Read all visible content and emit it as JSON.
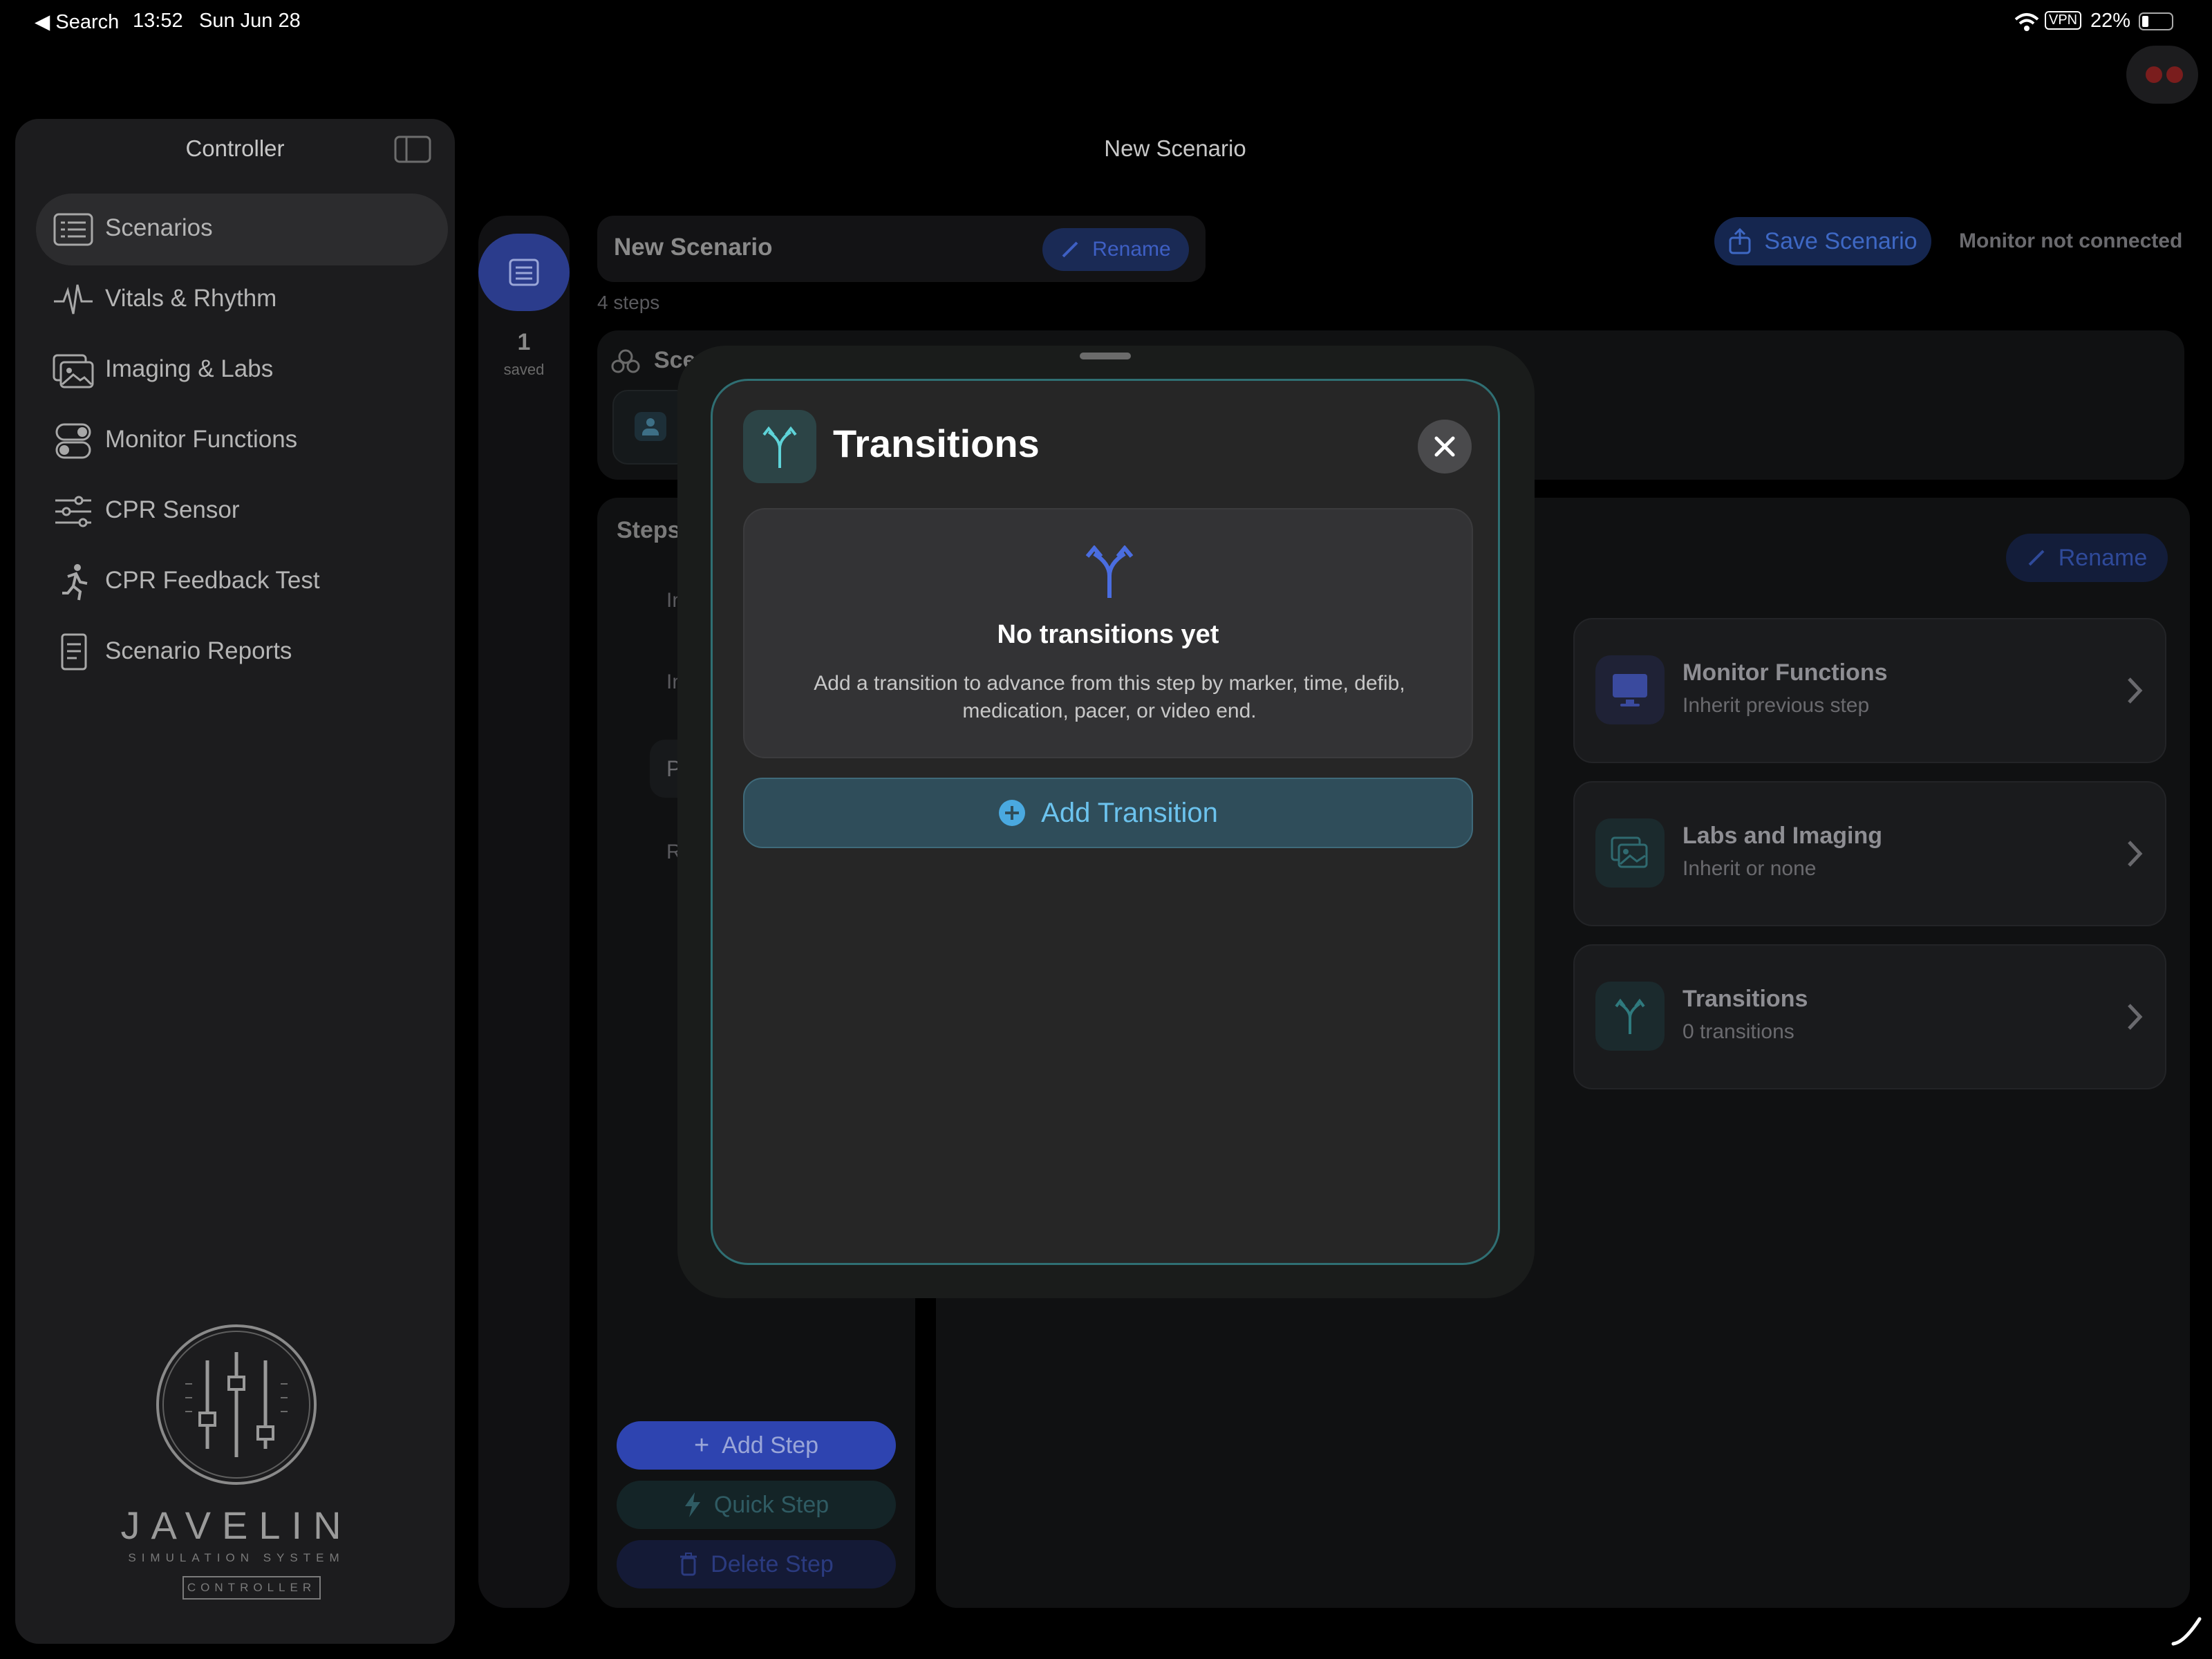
{
  "status_bar": {
    "back_label": "◀ Search",
    "time": "13:52",
    "date": "Sun Jun 28",
    "vpn": "VPN",
    "battery": "22%"
  },
  "sidebar": {
    "title": "Controller",
    "items": [
      {
        "label": "Scenarios",
        "icon": "list-icon",
        "active": true
      },
      {
        "label": "Vitals & Rhythm",
        "icon": "waveform-icon"
      },
      {
        "label": "Imaging & Labs",
        "icon": "photos-icon"
      },
      {
        "label": "Monitor Functions",
        "icon": "toggles-icon"
      },
      {
        "label": "CPR Sensor",
        "icon": "sliders-icon"
      },
      {
        "label": "CPR Feedback Test",
        "icon": "runner-icon"
      },
      {
        "label": "Scenario Reports",
        "icon": "document-icon"
      }
    ],
    "logo": {
      "name": "JAVELIN",
      "line1": "SIMULATION SYSTEM",
      "line2": "CONTROLLER"
    }
  },
  "header": {
    "title": "New Scenario",
    "save_label": "Save Scenario",
    "monitor_status": "Monitor not connected"
  },
  "scenario": {
    "name": "New Scenario",
    "rename_label": "Rename",
    "steps_count": "4 steps",
    "saved_count": "1",
    "saved_label": "saved",
    "section_partial": "Sce",
    "steps_title": "Steps",
    "step_rows": [
      "In",
      "In",
      "P",
      "R"
    ],
    "add_step": "Add Step",
    "quick_step": "Quick Step",
    "delete_step": "Delete Step"
  },
  "detail": {
    "rename_label": "Rename",
    "cards": [
      {
        "title": "Monitor Functions",
        "subtitle": "Inherit previous step",
        "icon": "monitor-icon"
      },
      {
        "title": "Labs and Imaging",
        "subtitle": "Inherit or none",
        "icon": "photos-icon"
      },
      {
        "title": "Transitions",
        "subtitle": "0 transitions",
        "icon": "branch-icon"
      }
    ]
  },
  "modal": {
    "title": "Transitions",
    "empty_title": "No transitions yet",
    "empty_desc": "Add a transition to advance from this step by marker, time, defib, medication, pacer, or video end.",
    "add_label": "Add Transition"
  },
  "colors": {
    "accent_teal": "#5ed3d8",
    "accent_blue": "#3b56d9",
    "add_transition_text": "#6cc3ee"
  }
}
